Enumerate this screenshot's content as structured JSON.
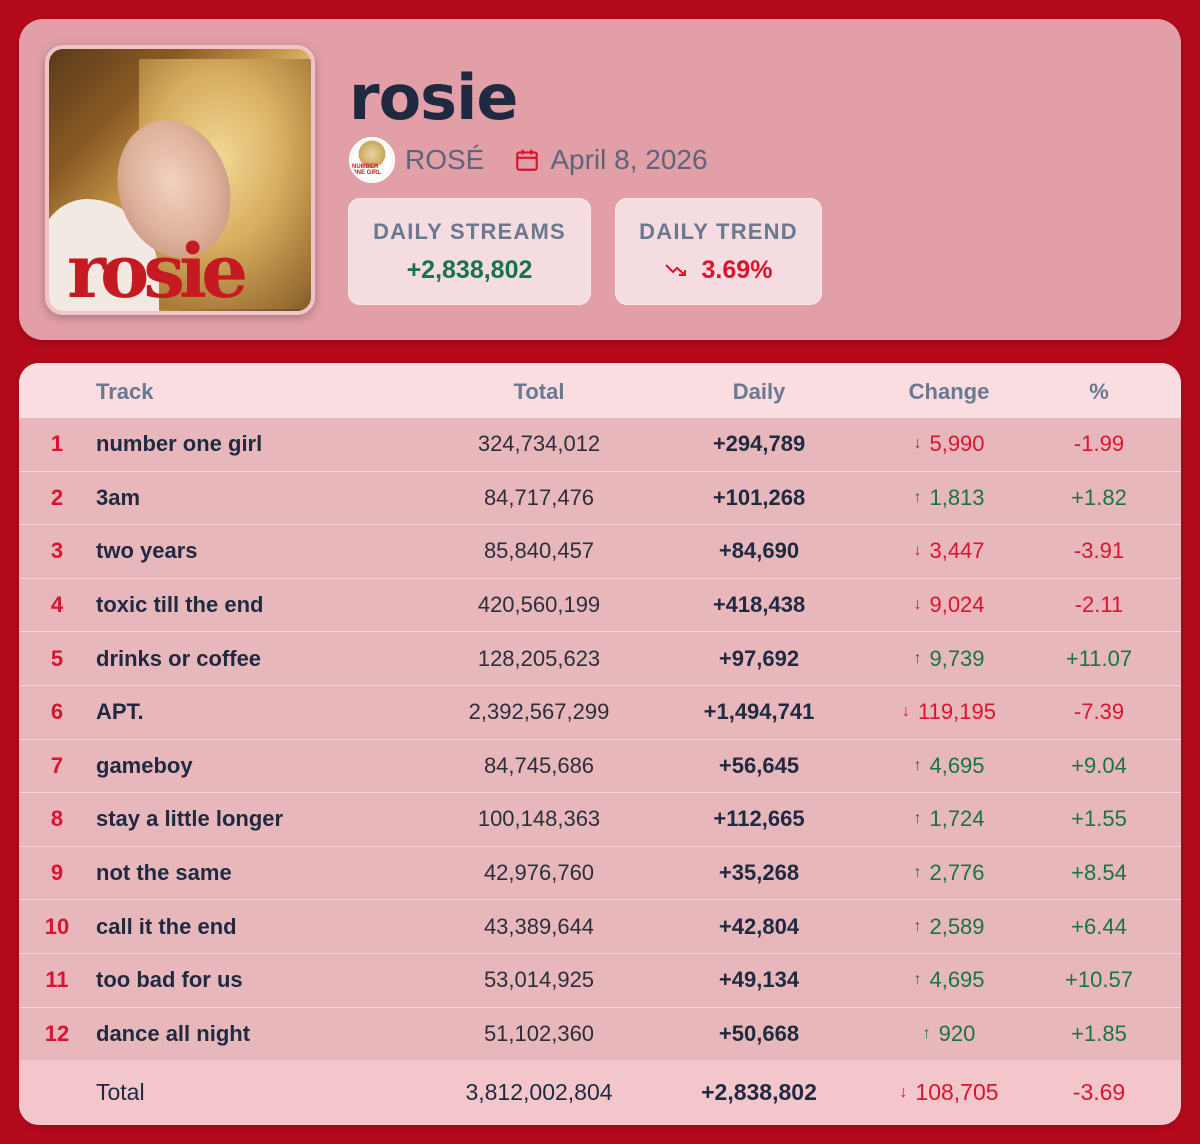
{
  "album": {
    "title": "rosie",
    "cover_text": "rosie",
    "avatar_text": "NUMBER ONE GIRL",
    "artist": "ROSÉ",
    "release_date": "April 8, 2026"
  },
  "stats": {
    "streams_label": "DAILY STREAMS",
    "streams_value": "+2,838,802",
    "trend_label": "DAILY TREND",
    "trend_value": "3.69%",
    "trend_icon": "trending-down-icon"
  },
  "colors": {
    "background": "#b50a1c",
    "positive": "#17734a",
    "negative": "#d8142e"
  },
  "table": {
    "headers": {
      "track": "Track",
      "total": "Total",
      "daily": "Daily",
      "change": "Change",
      "pct": "%"
    },
    "rows": [
      {
        "rank": "1",
        "track": "number one girl",
        "total": "324,734,012",
        "daily": "+294,789",
        "change": "5,990",
        "dir": "down",
        "pct": "-1.99"
      },
      {
        "rank": "2",
        "track": "3am",
        "total": "84,717,476",
        "daily": "+101,268",
        "change": "1,813",
        "dir": "up",
        "pct": "+1.82"
      },
      {
        "rank": "3",
        "track": "two years",
        "total": "85,840,457",
        "daily": "+84,690",
        "change": "3,447",
        "dir": "down",
        "pct": "-3.91"
      },
      {
        "rank": "4",
        "track": "toxic till the end",
        "total": "420,560,199",
        "daily": "+418,438",
        "change": "9,024",
        "dir": "down",
        "pct": "-2.11"
      },
      {
        "rank": "5",
        "track": "drinks or coffee",
        "total": "128,205,623",
        "daily": "+97,692",
        "change": "9,739",
        "dir": "up",
        "pct": "+11.07"
      },
      {
        "rank": "6",
        "track": "APT.",
        "total": "2,392,567,299",
        "daily": "+1,494,741",
        "change": "119,195",
        "dir": "down",
        "pct": "-7.39"
      },
      {
        "rank": "7",
        "track": "gameboy",
        "total": "84,745,686",
        "daily": "+56,645",
        "change": "4,695",
        "dir": "up",
        "pct": "+9.04"
      },
      {
        "rank": "8",
        "track": "stay a little longer",
        "total": "100,148,363",
        "daily": "+112,665",
        "change": "1,724",
        "dir": "up",
        "pct": "+1.55"
      },
      {
        "rank": "9",
        "track": "not the same",
        "total": "42,976,760",
        "daily": "+35,268",
        "change": "2,776",
        "dir": "up",
        "pct": "+8.54"
      },
      {
        "rank": "10",
        "track": "call it the end",
        "total": "43,389,644",
        "daily": "+42,804",
        "change": "2,589",
        "dir": "up",
        "pct": "+6.44"
      },
      {
        "rank": "11",
        "track": "too bad for us",
        "total": "53,014,925",
        "daily": "+49,134",
        "change": "4,695",
        "dir": "up",
        "pct": "+10.57"
      },
      {
        "rank": "12",
        "track": "dance all night",
        "total": "51,102,360",
        "daily": "+50,668",
        "change": "920",
        "dir": "up",
        "pct": "+1.85"
      }
    ],
    "footer": {
      "label": "Total",
      "total": "3,812,002,804",
      "daily": "+2,838,802",
      "change": "108,705",
      "dir": "down",
      "pct": "-3.69"
    }
  }
}
